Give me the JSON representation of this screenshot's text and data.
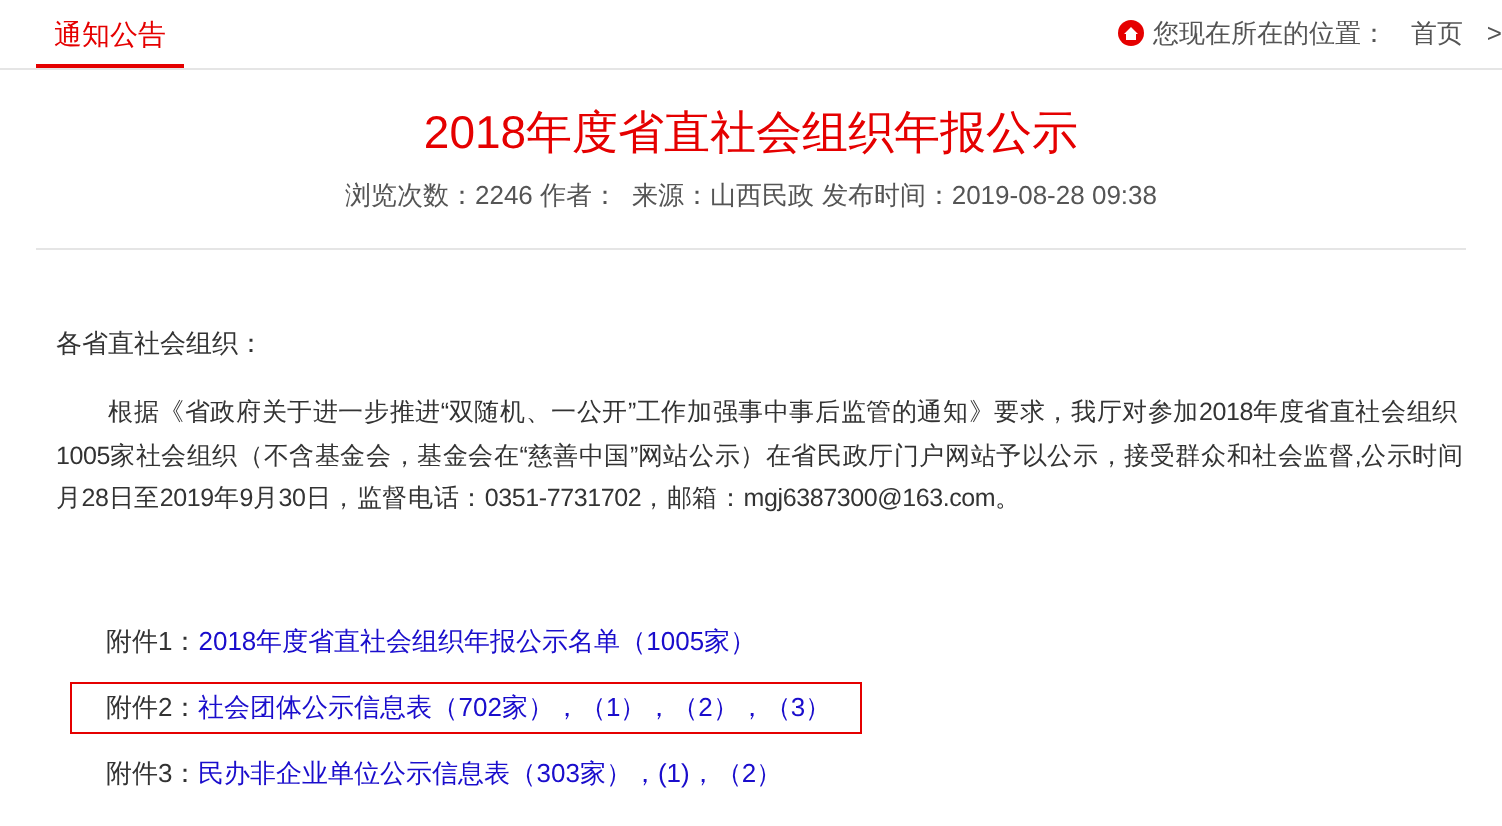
{
  "tab": {
    "label": "通知公告",
    "selected": true
  },
  "breadcrumb": {
    "label": "您现在所在的位置：",
    "items": [
      "首页",
      ">"
    ]
  },
  "article": {
    "title": "2018年度省直社会组织年报公示",
    "meta": "浏览次数：2246 作者：  来源：山西民政 发布时间：2019-08-28 09:38",
    "salutation": "各省直社会组织：",
    "paragraph_lines": [
      "根据《省政府关于进一步推进“双随机、一公开”工作加强事中事后监管的通知》要求，我厅对参加2018年度省直社会组织",
      "1005家社会组织（不含基金会，基金会在“慈善中国”网站公示）在省民政厅门户网站予以公示，接受群众和社会监督,公示时间",
      "月28日至2019年9月30日，监督电话：0351-7731702，邮箱：mgj6387300@163.com。"
    ],
    "attachments": [
      {
        "label": "附件1：",
        "links": [
          "2018年度省直社会组织年报公示名单（1005家）"
        ],
        "highlighted": false
      },
      {
        "label": "附件2：",
        "links": [
          "社会团体公示信息表（702家）",
          "（1）",
          "（2）",
          "（3）"
        ],
        "separator": "，",
        "highlighted": true
      },
      {
        "label": "附件3：",
        "links": [
          "民办非企业单位公示信息表（303家）",
          "(1)",
          "（2）"
        ],
        "separator": "，",
        "highlighted": false
      }
    ]
  }
}
